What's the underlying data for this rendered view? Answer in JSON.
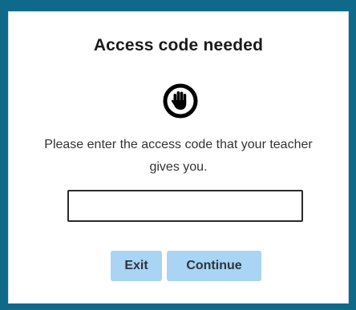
{
  "dialog": {
    "title": "Access code needed",
    "icon": "stop-hand-icon",
    "message": "Please enter the access code that your teacher gives you.",
    "input": {
      "value": "",
      "placeholder": ""
    },
    "buttons": {
      "exit_label": "Exit",
      "continue_label": "Continue"
    }
  },
  "colors": {
    "frame": "#0f6a8a",
    "button_bg": "#a9d4f3",
    "button_text": "#2b3440",
    "icon": "#000000"
  }
}
